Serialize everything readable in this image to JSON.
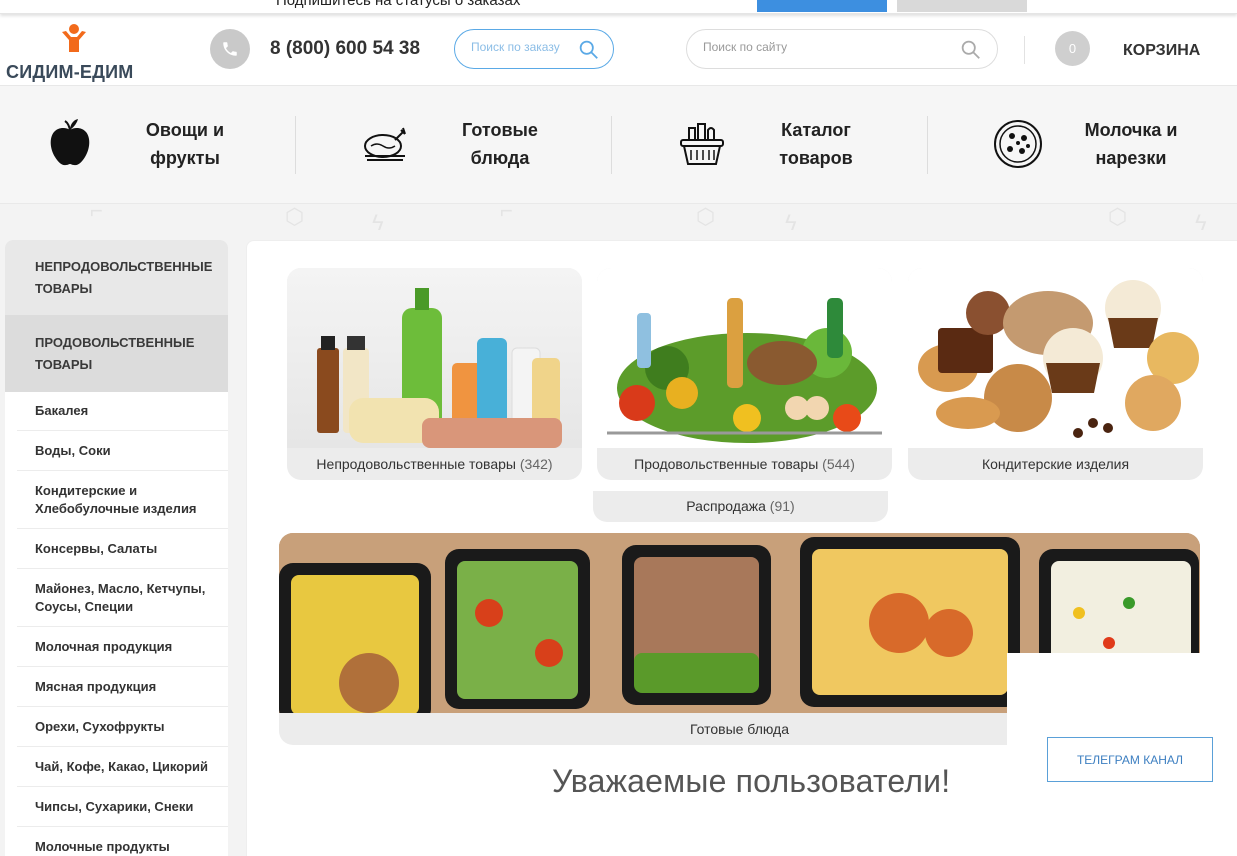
{
  "topbar": {
    "notice": "Подпишитесь на статусы о заказах"
  },
  "header": {
    "logo_text": "СИДИМ-ЕДИМ",
    "phone": "8 (800) 600 54 38",
    "order_search_placeholder": "Поиск по заказу",
    "site_search_placeholder": "Поиск по сайту",
    "cart_count": "0",
    "cart_label": "КОРЗИНА"
  },
  "categories": [
    {
      "label": "Овощи и фрукты",
      "icon": "apple-icon"
    },
    {
      "label": "Готовые блюда",
      "icon": "roast-chicken-icon"
    },
    {
      "label": "Каталог товаров",
      "icon": "grocery-basket-icon"
    },
    {
      "label": "Молочка и нарезки",
      "icon": "pizza-icon"
    }
  ],
  "sidebar": {
    "top_items": [
      "НЕПРОДОВОЛЬСТВЕННЫЕ ТОВАРЫ",
      "ПРОДОВОЛЬСТВЕННЫЕ ТОВАРЫ"
    ],
    "items": [
      "Бакалея",
      "Воды, Соки",
      "Кондитерские и Хлебобулочные изделия",
      "Консервы, Салаты",
      "Майонез, Масло, Кетчупы, Соусы, Специи",
      "Молочная продукция",
      "Мясная продукция",
      "Орехи, Сухофрукты",
      "Чай, Кофе, Какао, Цикорий",
      "Чипсы, Сухарики, Снеки",
      "Молочные продукты"
    ]
  },
  "tiles": [
    {
      "title": "Непродовольственные товары",
      "count": "(342)"
    },
    {
      "title": "Продовольственные товары",
      "count": "(544)"
    },
    {
      "title": "Кондитерские изделия",
      "count": ""
    }
  ],
  "sale": {
    "title": "Распродажа",
    "count": "(91)"
  },
  "ready_meals": {
    "title": "Готовые блюда"
  },
  "telegram_button": "ТЕЛЕГРАМ КАНАЛ",
  "welcome_heading": "Уважаемые пользователи!",
  "colors": {
    "accent_blue": "#3d8fe0",
    "logo_orange": "#f26a1b",
    "logo_text": "#3a4a5a"
  }
}
